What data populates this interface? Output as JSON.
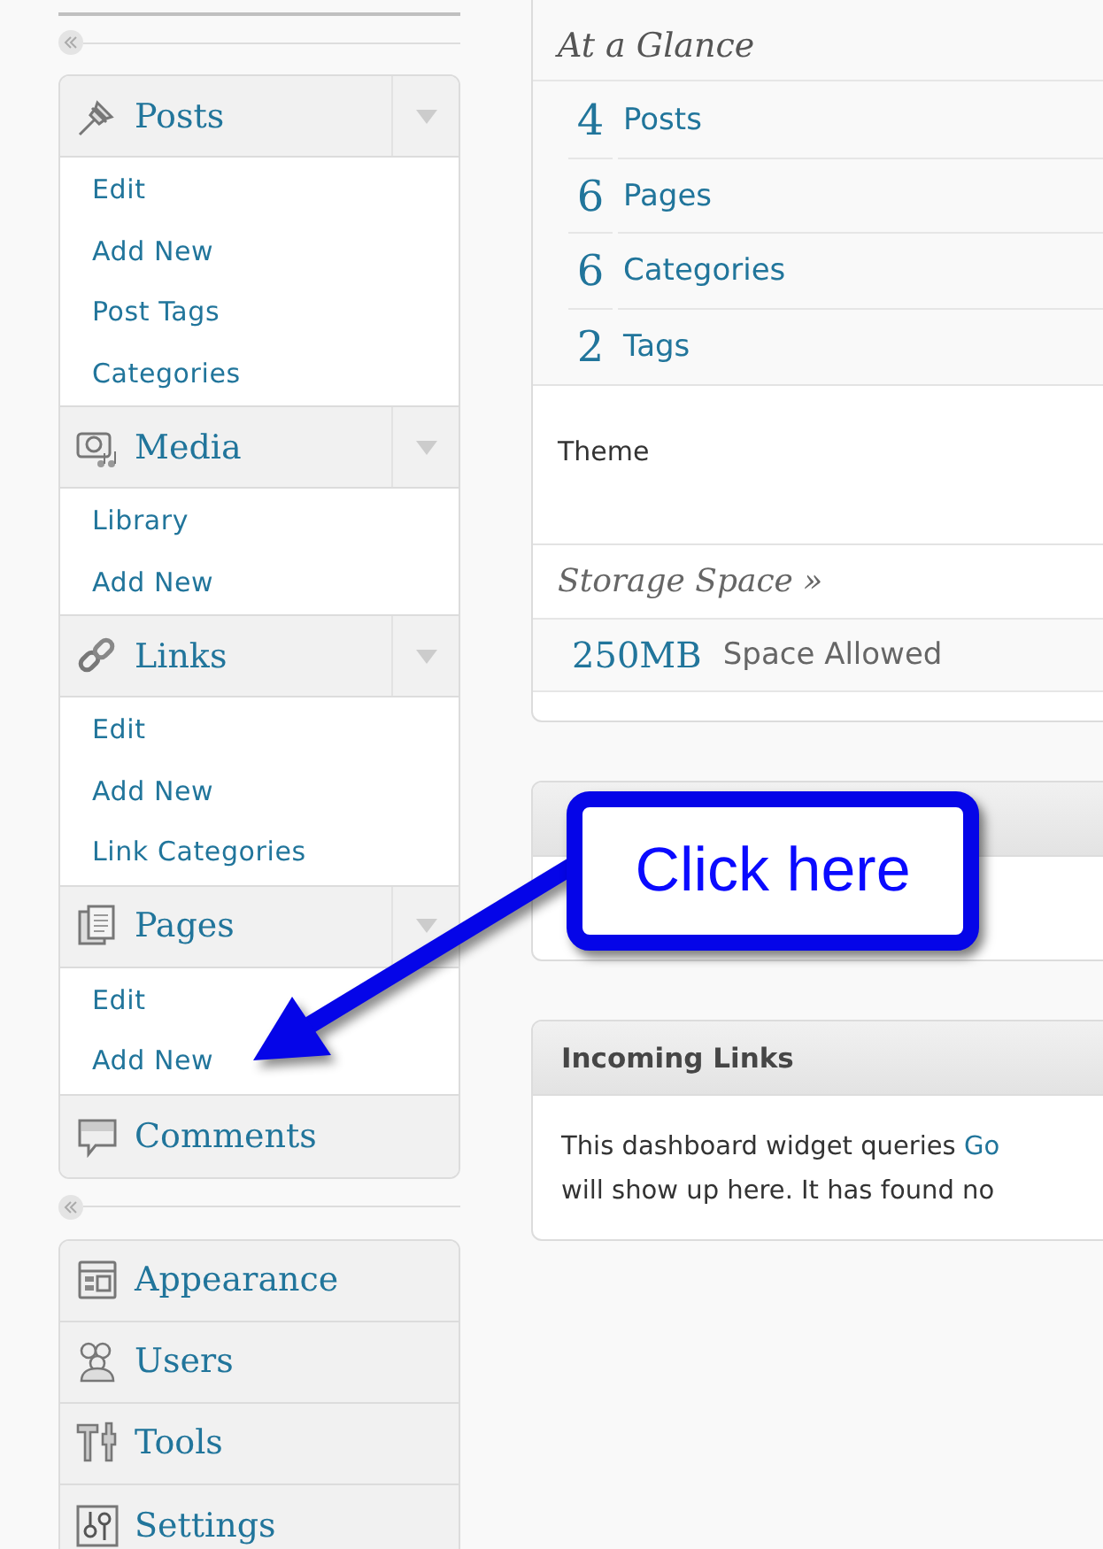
{
  "sidebar": {
    "menu_groups": [
      {
        "items": [
          {
            "label": "Posts",
            "submenu": [
              "Edit",
              "Add New",
              "Post Tags",
              "Categories"
            ]
          },
          {
            "label": "Media",
            "submenu": [
              "Library",
              "Add New"
            ]
          },
          {
            "label": "Links",
            "submenu": [
              "Edit",
              "Add New",
              "Link Categories"
            ]
          },
          {
            "label": "Pages",
            "submenu": [
              "Edit",
              "Add New"
            ]
          },
          {
            "label": "Comments"
          }
        ]
      },
      {
        "items": [
          {
            "label": "Appearance"
          },
          {
            "label": "Users"
          },
          {
            "label": "Tools"
          },
          {
            "label": "Settings"
          }
        ]
      }
    ]
  },
  "at_a_glance": {
    "title": "At a Glance",
    "rows": [
      {
        "count": "4",
        "label": "Posts"
      },
      {
        "count": "6",
        "label": "Pages"
      },
      {
        "count": "6",
        "label": "Categories"
      },
      {
        "count": "2",
        "label": "Tags"
      }
    ],
    "theme": "Theme",
    "storage_title": "Storage Space »",
    "storage_value": "250MB",
    "storage_label": "Space Allowed"
  },
  "incoming_links": {
    "title": "Incoming Links",
    "text_before": "This dashboard widget queries",
    "link": "Go",
    "text_after": "will show up here. It has found no"
  },
  "callout": {
    "text": "Click here"
  }
}
